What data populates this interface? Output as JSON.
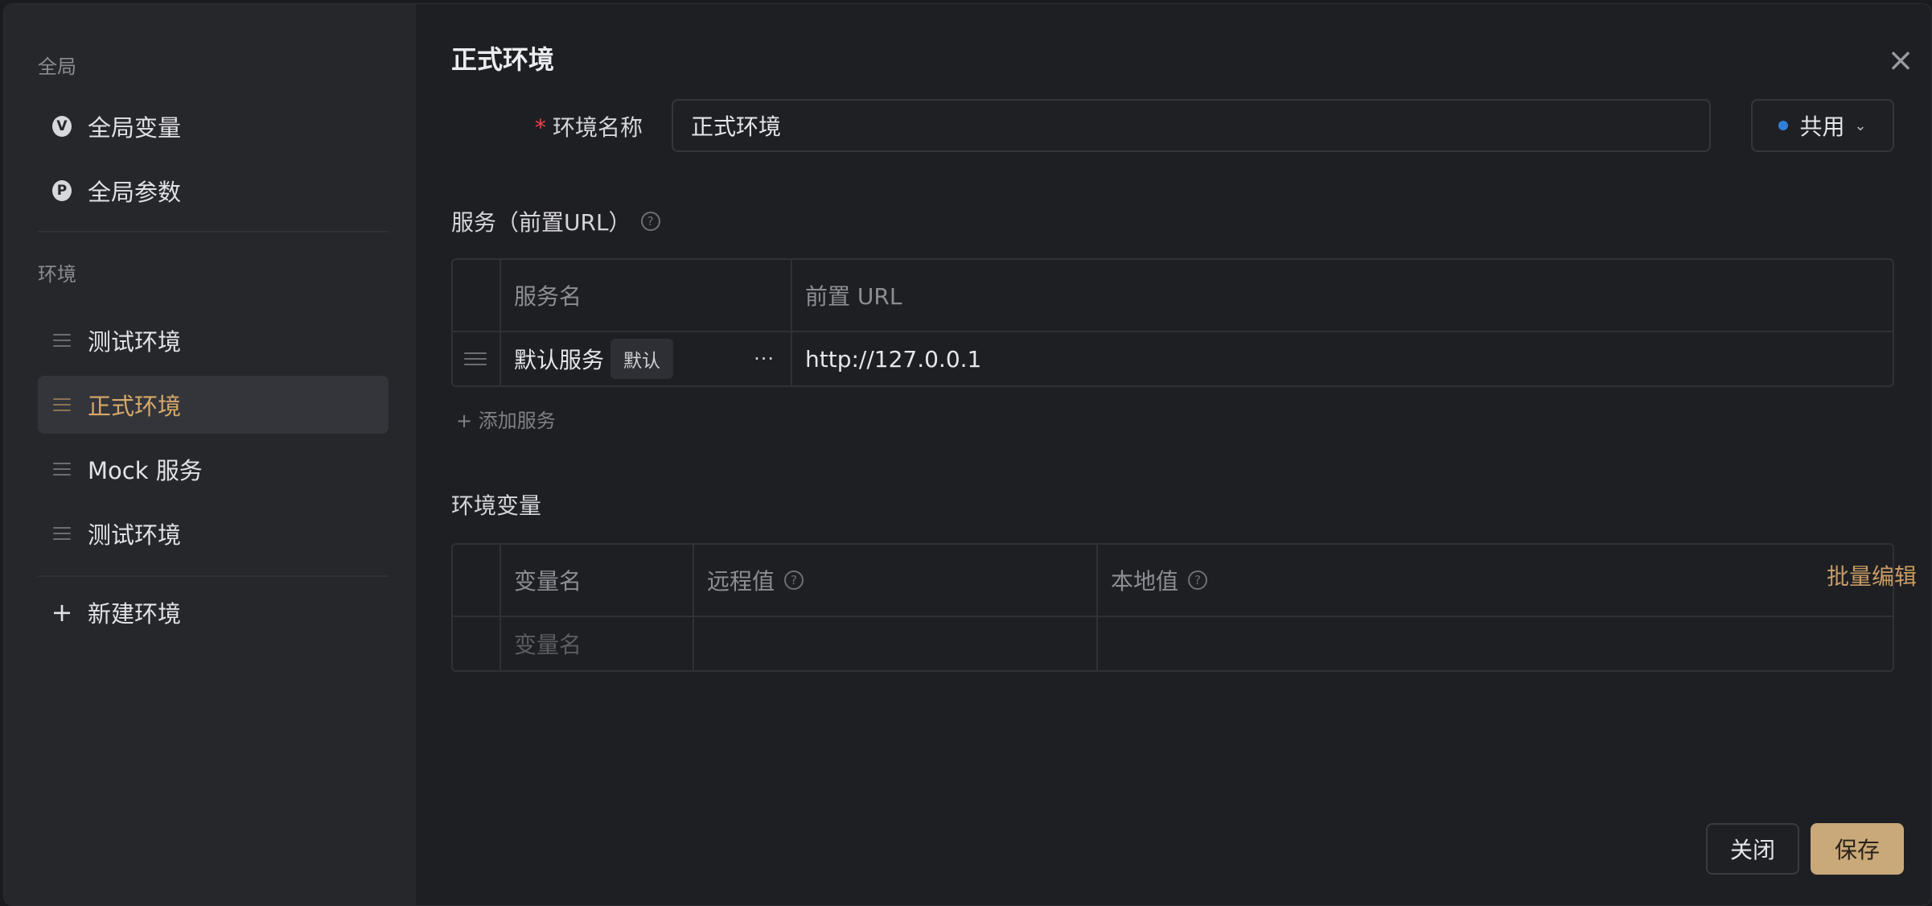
{
  "sidebar": {
    "global_title": "全局",
    "global_items": [
      {
        "label": "全局变量",
        "icon": "v-badge-icon",
        "glyph": "V"
      },
      {
        "label": "全局参数",
        "icon": "p-badge-icon",
        "glyph": "P"
      }
    ],
    "env_title": "环境",
    "env_items": [
      {
        "label": "测试环境",
        "active": false
      },
      {
        "label": "正式环境",
        "active": true
      },
      {
        "label": "Mock 服务",
        "active": false
      },
      {
        "label": "测试环境",
        "active": false
      }
    ],
    "new_env_label": "新建环境"
  },
  "main": {
    "title": "正式环境",
    "name_field": {
      "required_mark": "*",
      "label": "环境名称",
      "value": "正式环境"
    },
    "share": {
      "label": "共用",
      "dot_color": "#2f7fd8"
    },
    "services": {
      "title": "服务（前置URL）",
      "headers": [
        "服务名",
        "前置 URL"
      ],
      "rows": [
        {
          "name": "默认服务",
          "tag": "默认",
          "more": "···",
          "url": "http://127.0.0.1"
        }
      ],
      "add_label": "添加服务"
    },
    "variables": {
      "title": "环境变量",
      "headers": [
        "变量名",
        "远程值",
        "本地值"
      ],
      "batch_edit": "批量编辑",
      "empty_row_placeholder": "变量名"
    },
    "buttons": {
      "close": "关闭",
      "save": "保存"
    }
  },
  "colors": {
    "accent": "#c9a879",
    "active_text": "#d6a96b",
    "required": "#e5484d"
  }
}
